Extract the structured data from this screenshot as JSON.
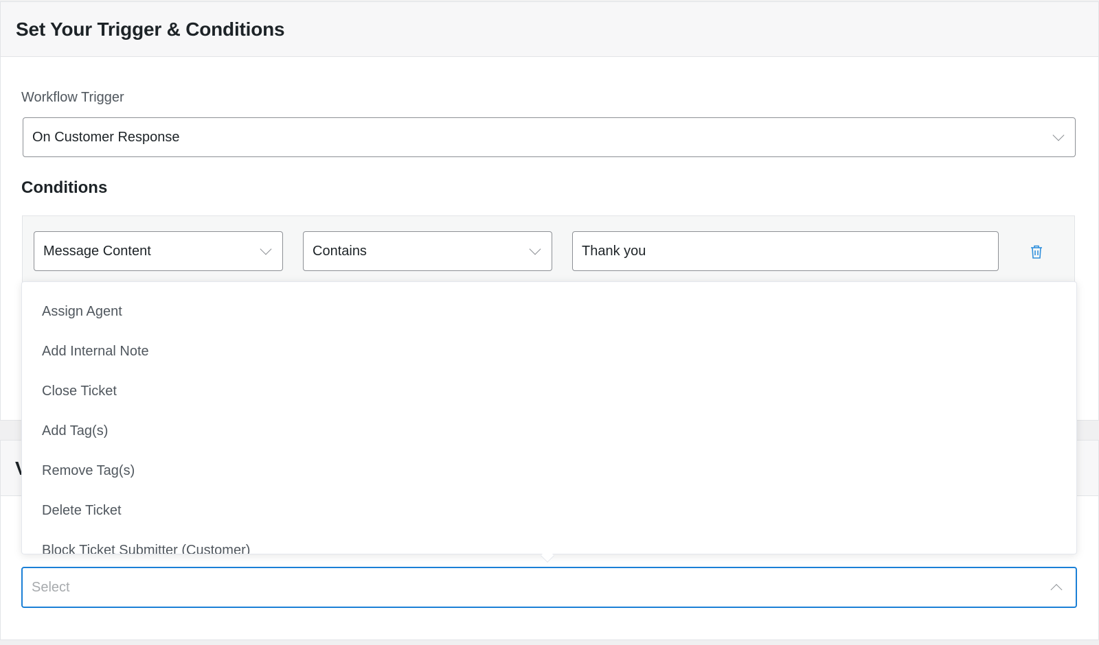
{
  "card1": {
    "title": "Set Your Trigger & Conditions",
    "trigger_label": "Workflow Trigger",
    "trigger_value": "On Customer Response",
    "conditions_heading": "Conditions",
    "condition": {
      "field": "Message Content",
      "operator": "Contains",
      "value": "Thank you"
    }
  },
  "card2": {
    "title_visible_fragment": "V"
  },
  "dropdown": {
    "items": [
      "Assign Agent",
      "Add Internal Note",
      "Close Ticket",
      "Add Tag(s)",
      "Remove Tag(s)",
      "Delete Ticket",
      "Block Ticket Submitter (Customer)"
    ]
  },
  "action_select": {
    "placeholder": "Select"
  },
  "colors": {
    "accent": "#1a7fd6",
    "trash_icon": "#2f8fdc",
    "header_bg": "#f7f7f8",
    "condition_bg": "#f6f7f7"
  }
}
